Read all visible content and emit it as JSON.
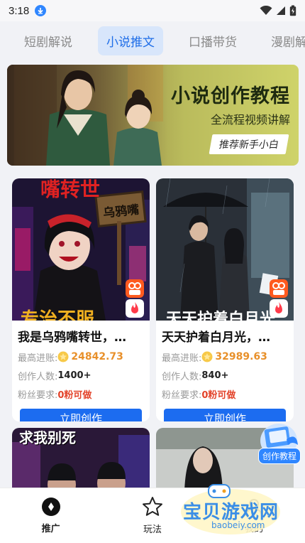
{
  "status": {
    "time": "3:18"
  },
  "tabs": [
    {
      "label": "短剧解说"
    },
    {
      "label": "小说推文"
    },
    {
      "label": "口播带货"
    },
    {
      "label": "漫剧解"
    }
  ],
  "banner": {
    "title": "小说创作教程",
    "subtitle": "全流程视频讲解",
    "tag": "推荐新手小白"
  },
  "cards": [
    {
      "overlay_top": "嘴转世",
      "sign": "乌鸦嘴",
      "overlay_bottom": "专治不服",
      "title": "我是乌鸦嘴转世，…",
      "income_label": "最高进账:",
      "income": "24842.73",
      "creators_label": "创作人数:",
      "creators": "1400+",
      "fans_label": "粉丝要求:",
      "fans": "0粉可做",
      "cta": "立即创作"
    },
    {
      "overlay_bottom": "天天护着白月光",
      "title": "天天护着白月光，…",
      "income_label": "最高进账:",
      "income": "32989.63",
      "creators_label": "创作人数:",
      "creators": "840+",
      "fans_label": "粉丝要求:",
      "fans": "0粉可做",
      "cta": "立即创作"
    }
  ],
  "cards_below": [
    {
      "overlay_top": "求我别死"
    },
    {
      "overlay_top": ""
    }
  ],
  "float": {
    "label": "创作教程"
  },
  "watermark": {
    "text": "宝贝游戏网",
    "sub": "baobeiy.com"
  },
  "nav": [
    {
      "label": "推广",
      "icon": "disc-icon"
    },
    {
      "label": "玩法",
      "icon": "star-icon"
    },
    {
      "label": "我的",
      "icon": "user-icon"
    }
  ],
  "colors": {
    "accent": "#1c6cf0",
    "money": "#e8902a",
    "red": "#e3442b"
  }
}
